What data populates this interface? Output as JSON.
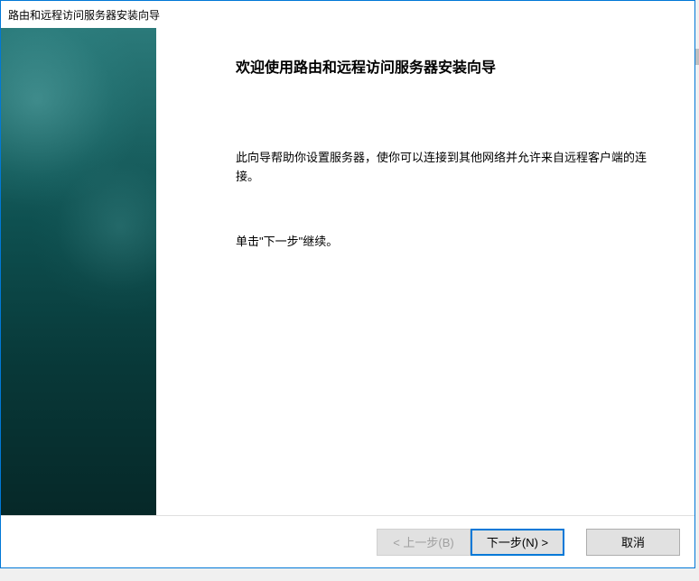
{
  "window": {
    "title": "路由和远程访问服务器安装向导"
  },
  "content": {
    "heading": "欢迎使用路由和远程访问服务器安装向导",
    "description": "此向导帮助你设置服务器，使你可以连接到其他网络并允许来自远程客户端的连接。",
    "instruction": "单击\"下一步\"继续。"
  },
  "buttons": {
    "back": "< 上一步(B)",
    "next": "下一步(N) >",
    "cancel": "取消"
  }
}
